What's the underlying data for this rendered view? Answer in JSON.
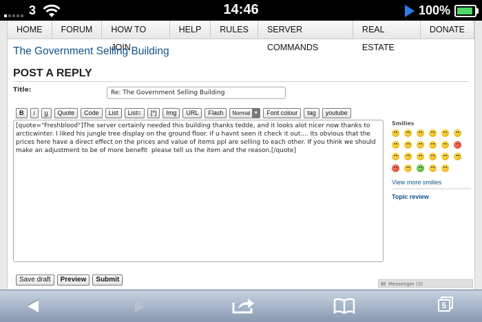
{
  "status_bar": {
    "carrier": "3",
    "time": "14:46",
    "battery_percent": "100%",
    "battery_level": 1.0,
    "signal_bars_filled": 1
  },
  "nav": {
    "items": [
      "HOME",
      "FORUM",
      "HOW TO JOIN",
      "HELP",
      "RULES",
      "SERVER COMMANDS",
      "REAL ESTATE",
      "DONATE"
    ]
  },
  "topic": {
    "title": "The Government Selling Building"
  },
  "form": {
    "heading": "POST A REPLY",
    "title_label": "Title:",
    "title_value": "Re: The Government Selling Building",
    "toolbar": {
      "bold": "B",
      "italic": "i",
      "underline": "u",
      "quote": "Quote",
      "code": "Code",
      "list": "List",
      "list_eq": "List=",
      "list_item": "[*]",
      "img": "Img",
      "url": "URL",
      "flash": "Flash",
      "font_size": "Normal",
      "font_colour": "Font colour",
      "tag": "tag",
      "youtube": "youtube"
    },
    "message": "[quote=\"Freshblood\"]The server certainly needed this building thanks tedde, and it looks alot nicer now thanks to arcticwinter. I liked his jungle tree display on the ground floor. if u havnt seen it check it out.... Its obvious that the prices here have a direct effect on the prices and value of items ppl are selling to each other. If you think we should make an adjustment to be of more benefit  please tell us the item and the reason.[/quote]",
    "buttons": {
      "save_draft": "Save draft",
      "preview": "Preview",
      "submit": "Submit"
    }
  },
  "sidebar": {
    "smilies_title": "Smilies",
    "view_more": "View more smilies",
    "topic_review": "Topic review"
  },
  "messenger": {
    "label": "Messenger (3)"
  },
  "colors": {
    "link": "#105289",
    "battery_fill": "#4cd964",
    "play_icon": "#2b7de9"
  }
}
